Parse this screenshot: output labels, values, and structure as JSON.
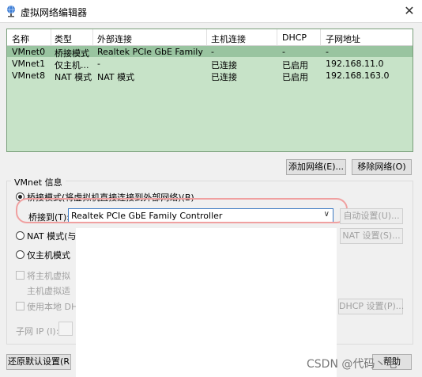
{
  "window": {
    "title": "虚拟网络编辑器",
    "close_glyph": "✕"
  },
  "table": {
    "columns": [
      "名称",
      "类型",
      "外部连接",
      "主机连接",
      "DHCP",
      "子网地址"
    ],
    "rows": [
      [
        "VMnet0",
        "桥接模式",
        "Realtek PCIe GbE Family Co...",
        "-",
        "-",
        "-"
      ],
      [
        "VMnet1",
        "仅主机...",
        "-",
        "已连接",
        "已启用",
        "192.168.11.0"
      ],
      [
        "VMnet8",
        "NAT 模式",
        "NAT 模式",
        "已连接",
        "已启用",
        "192.168.163.0"
      ]
    ]
  },
  "buttons": {
    "add_network": "添加网络(E)...",
    "remove_network": "移除网络(O)",
    "auto_settings": "自动设置(U)...",
    "nat_settings": "NAT 设置(S)...",
    "dhcp_settings": "DHCP 设置(P)...",
    "restore_defaults": "还原默认设置(R",
    "help": "帮助"
  },
  "vmnet_info": {
    "group_label": "VMnet 信息",
    "bridged_label": "桥接模式(将虚拟机直接连接到外部网络)(B)",
    "bridged_to_label": "桥接到(T):",
    "bridged_to_value": "Realtek PCIe GbE Family Controller",
    "nat_label": "NAT 模式(与",
    "hostonly_label": "仅主机模式",
    "connect_host_label": "将主机虚拟",
    "host_adapter_label": "主机虚拟适",
    "use_local_dhcp_label": "使用本地 DH",
    "subnet_ip_label": "子网 IP (I):"
  },
  "watermark": "CSDN @代码丶毛"
}
